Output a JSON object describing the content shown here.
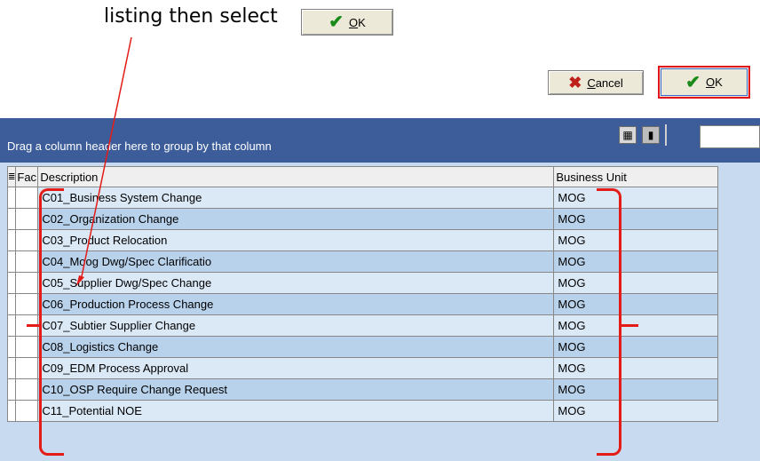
{
  "caption": "listing then select",
  "buttons": {
    "ok_top_label": "OK",
    "cancel_label": "Cancel",
    "ok_label": "OK"
  },
  "groupbar": {
    "text": "Drag a column header here to group by that column"
  },
  "columns": {
    "selector": "≣",
    "fac": "Fac",
    "description": "Description",
    "business_unit": "Business Unit"
  },
  "rows": [
    {
      "description": "C01_Business System Change",
      "business_unit": "MOG"
    },
    {
      "description": "C02_Organization Change",
      "business_unit": "MOG"
    },
    {
      "description": "C03_Product Relocation",
      "business_unit": "MOG"
    },
    {
      "description": "C04_Moog Dwg/Spec Clarificatio",
      "business_unit": "MOG"
    },
    {
      "description": "C05_Supplier Dwg/Spec Change",
      "business_unit": "MOG"
    },
    {
      "description": "C06_Production Process Change",
      "business_unit": "MOG"
    },
    {
      "description": "C07_Subtier Supplier Change",
      "business_unit": "MOG"
    },
    {
      "description": "C08_Logistics Change",
      "business_unit": "MOG"
    },
    {
      "description": "C09_EDM Process Approval",
      "business_unit": "MOG"
    },
    {
      "description": "C10_OSP Require Change Request",
      "business_unit": "MOG"
    },
    {
      "description": "C11_Potential NOE",
      "business_unit": "MOG"
    }
  ],
  "colors": {
    "accent_red": "#e41b17",
    "groupbar_bg": "#3c5d9a",
    "check_green": "#1a8a1a"
  }
}
